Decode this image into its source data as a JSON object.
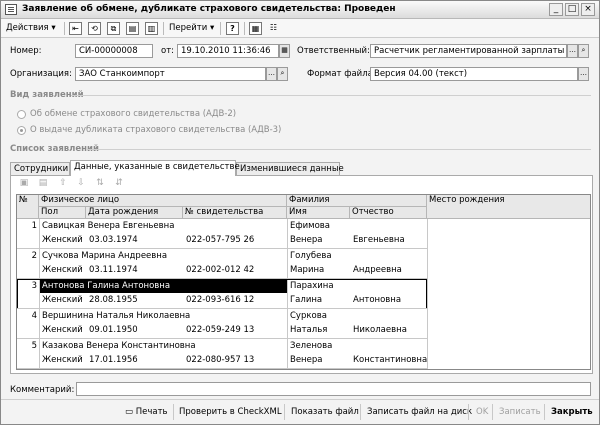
{
  "window": {
    "title": "Заявление об обмене, дубликате страхового свидетельства: Проведен"
  },
  "toolbar": {
    "actions": "Действия",
    "goto": "Перейти",
    "help": "?"
  },
  "form": {
    "number_label": "Номер:",
    "number_value": "СИ-00000008",
    "date_label": "от:",
    "date_value": "19.10.2010 11:36:46",
    "responsible_label": "Ответственный:",
    "responsible_value": "Расчетчик регламентированной зарплаты",
    "org_label": "Организация:",
    "org_value": "ЗАО Станкоимпорт",
    "format_label": "Формат файла:",
    "format_value": "Версия 04.00 (текст)"
  },
  "kind": {
    "title": "Вид заявлений",
    "opt1": "Об обмене страхового свидетельства (АДВ-2)",
    "opt2": "О выдаче дубликата страхового свидетельства (АДВ-3)"
  },
  "list": {
    "title": "Список заявлений"
  },
  "tabs": [
    "Сотрудники",
    "Данные, указанные в свидетельстве",
    "Изменившиеся данные"
  ],
  "table": {
    "headers": {
      "num": "№",
      "person": "Физическое лицо",
      "gender": "Пол",
      "birthdate": "Дата рождения",
      "cert": "№ свидетельства",
      "surname_group": "Фамилия",
      "name": "Имя",
      "patronymic": "Отчество",
      "birthplace": "Место рождения"
    },
    "rows": [
      {
        "n": "1",
        "person": "Савицкая Венера Евгеньевна",
        "gender": "Женский",
        "birth": "03.03.1974",
        "cert": "022-057-795 26",
        "surname": "Ефимова",
        "name": "Венера",
        "patronymic": "Евгеньевна"
      },
      {
        "n": "2",
        "person": "Сучкова Марина Андреевна",
        "gender": "Женский",
        "birth": "03.11.1974",
        "cert": "022-002-012 42",
        "surname": "Голубева",
        "name": "Марина",
        "patronymic": "Андреевна"
      },
      {
        "n": "3",
        "person": "Антонова Галина Антоновна",
        "gender": "Женский",
        "birth": "28.08.1955",
        "cert": "022-093-616 12",
        "surname": "Парахина",
        "name": "Галина",
        "patronymic": "Антоновна"
      },
      {
        "n": "4",
        "person": "Вершинина Наталья Николаевна",
        "gender": "Женский",
        "birth": "09.01.1950",
        "cert": "022-059-249 13",
        "surname": "Суркова",
        "name": "Наталья",
        "patronymic": "Николаевна"
      },
      {
        "n": "5",
        "person": "Казакова Венера Константиновна",
        "gender": "Женский",
        "birth": "17.01.1956",
        "cert": "022-080-957 13",
        "surname": "Зеленова",
        "name": "Венера",
        "patronymic": "Константиновна"
      }
    ]
  },
  "comment": {
    "label": "Комментарий:"
  },
  "footer": {
    "print": "Печать",
    "check": "Проверить в CheckXML",
    "show": "Показать файл",
    "save": "Записать файл на диск",
    "ok": "OK",
    "write": "Записать",
    "close": "Закрыть"
  }
}
